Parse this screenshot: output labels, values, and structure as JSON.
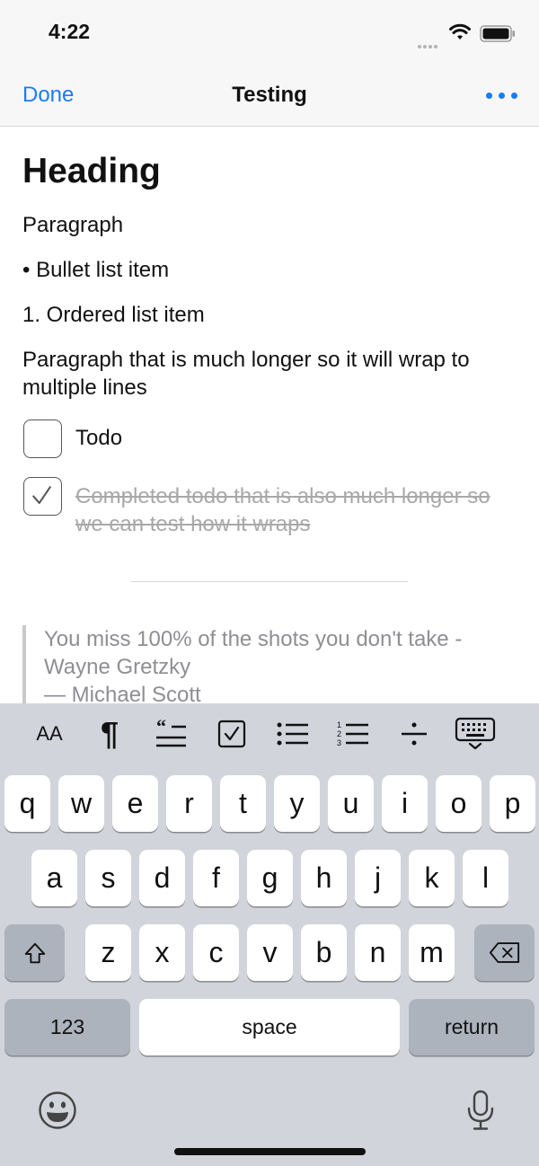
{
  "status": {
    "time": "4:22"
  },
  "nav": {
    "done_label": "Done",
    "title": "Testing"
  },
  "editor": {
    "heading": "Heading",
    "paragraph": "Paragraph",
    "bullet_item": "• Bullet list item",
    "ordered_item": "1. Ordered list item",
    "long_paragraph": "Paragraph that is much longer so it will wrap to multiple lines",
    "todo": {
      "label": "Todo",
      "checked": false
    },
    "todo_done": {
      "label": "Completed todo that is also much longer so we can test how it wraps",
      "checked": true
    },
    "quote": {
      "text": "You miss 100% of the shots you don't take - Wayne Gretzky",
      "attribution": "— Michael Scott"
    }
  },
  "toolbar": {
    "items": [
      {
        "icon": "text-size-icon",
        "label": "AA"
      },
      {
        "icon": "paragraph-icon",
        "label": "¶"
      },
      {
        "icon": "quote-icon"
      },
      {
        "icon": "checkbox-icon"
      },
      {
        "icon": "bullet-list-icon"
      },
      {
        "icon": "ordered-list-icon"
      },
      {
        "icon": "divider-icon"
      },
      {
        "icon": "keyboard-dismiss-icon"
      }
    ]
  },
  "keyboard": {
    "row1": [
      "q",
      "w",
      "e",
      "r",
      "t",
      "y",
      "u",
      "i",
      "o",
      "p"
    ],
    "row2": [
      "a",
      "s",
      "d",
      "f",
      "g",
      "h",
      "j",
      "k",
      "l"
    ],
    "row3": [
      "z",
      "x",
      "c",
      "v",
      "b",
      "n",
      "m"
    ],
    "numbers_label": "123",
    "space_label": "space",
    "return_label": "return"
  },
  "colors": {
    "accent": "#1a7cf5",
    "keyboard_bg": "#d1d4db",
    "completed_text": "#a8a8a8"
  }
}
